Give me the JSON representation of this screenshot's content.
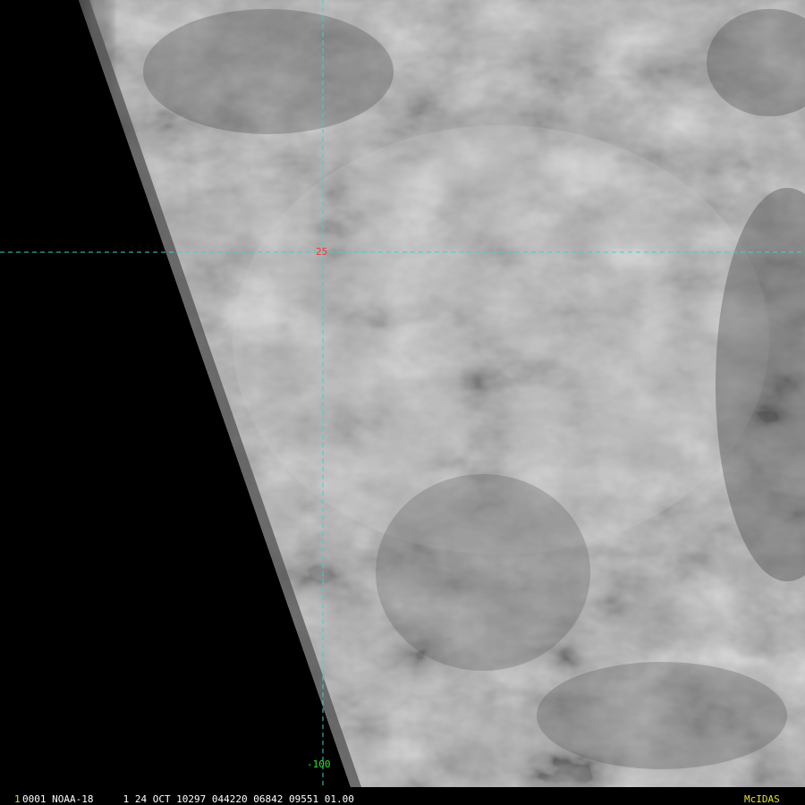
{
  "overlay": {
    "latitude_label": "25",
    "longitude_label": "-100",
    "grid_color": "#3fd0d0",
    "latitude_label_color": "#ff3030",
    "longitude_label_color": "#30e030"
  },
  "footer": {
    "frame_number": "1",
    "info_text": "0001 NOAA-18     1 24 OCT 10297 044220 06842 09551 01.00",
    "brand": "McIDAS",
    "frame_color": "#e0e020",
    "info_color": "#ffffff",
    "brand_color": "#e0e020"
  },
  "imagery": {
    "description_color_space": "grayscale",
    "background_color": "#000000"
  }
}
